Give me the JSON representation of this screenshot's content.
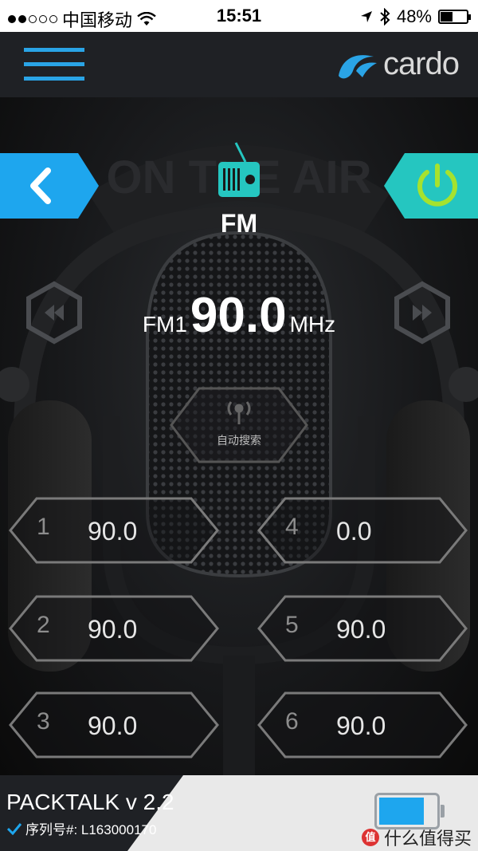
{
  "status_bar": {
    "signal_filled": 2,
    "signal_total": 5,
    "carrier": "中国移动",
    "time": "15:51",
    "battery_text": "48%",
    "battery_level": 0.48
  },
  "header": {
    "menu_icon": "hamburger-menu-icon",
    "brand": "cardo",
    "brand_color": "#2aa4e6"
  },
  "radio": {
    "mode": "FM",
    "band": "FM1",
    "frequency": "90.0",
    "unit": "MHz",
    "auto_scan_label": "自动搜索",
    "accent_cyan": "#25c6c0",
    "accent_blue": "#2aa4e6",
    "power_green": "#a6e22e",
    "background_text": "ON THE AIR",
    "presets": [
      {
        "number": "1",
        "value": "90.0"
      },
      {
        "number": "2",
        "value": "90.0"
      },
      {
        "number": "3",
        "value": "90.0"
      },
      {
        "number": "4",
        "value": "0.0"
      },
      {
        "number": "5",
        "value": "90.0"
      },
      {
        "number": "6",
        "value": "90.0"
      }
    ]
  },
  "footer": {
    "device_name": "PACKTALK v 2.2",
    "serial_label": "序列号#: L163000170",
    "device_battery_level": 0.8,
    "watermark": "什么值得买",
    "watermark_logo": "值"
  }
}
